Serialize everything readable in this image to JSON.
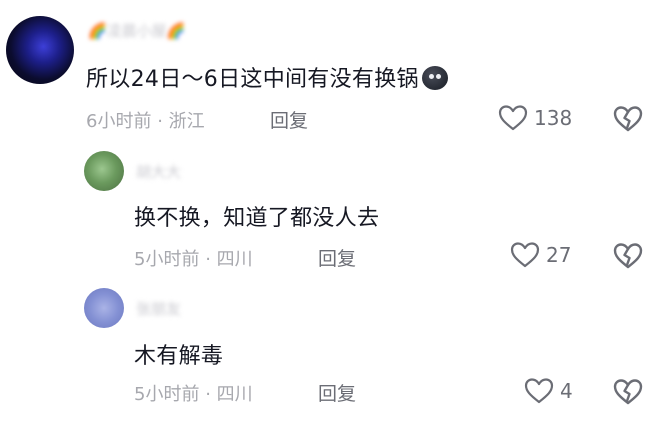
{
  "comments": [
    {
      "username": "🌈凌晨小屋🌈",
      "text": "所以24日～6日这中间有没有换锅",
      "emoji": "dark-blob-emoji",
      "time": "6小时前",
      "location": "浙江",
      "reply_label": "回复",
      "likes": "138"
    },
    {
      "username": "胡大大",
      "text": "换不换，知道了都没人去",
      "time": "5小时前",
      "location": "四川",
      "reply_label": "回复",
      "likes": "27"
    },
    {
      "username": "张朋友",
      "text": "木有解毒",
      "time": "5小时前",
      "location": "四川",
      "reply_label": "回复",
      "likes": "4"
    }
  ],
  "meta_separator": "·",
  "icons": {
    "like": "heart-outline-icon",
    "dislike": "broken-heart-icon"
  },
  "colors": {
    "text": "#161823",
    "meta": "#a7a8ae",
    "reply": "#6b6d75",
    "icon": "#6b6d75"
  }
}
